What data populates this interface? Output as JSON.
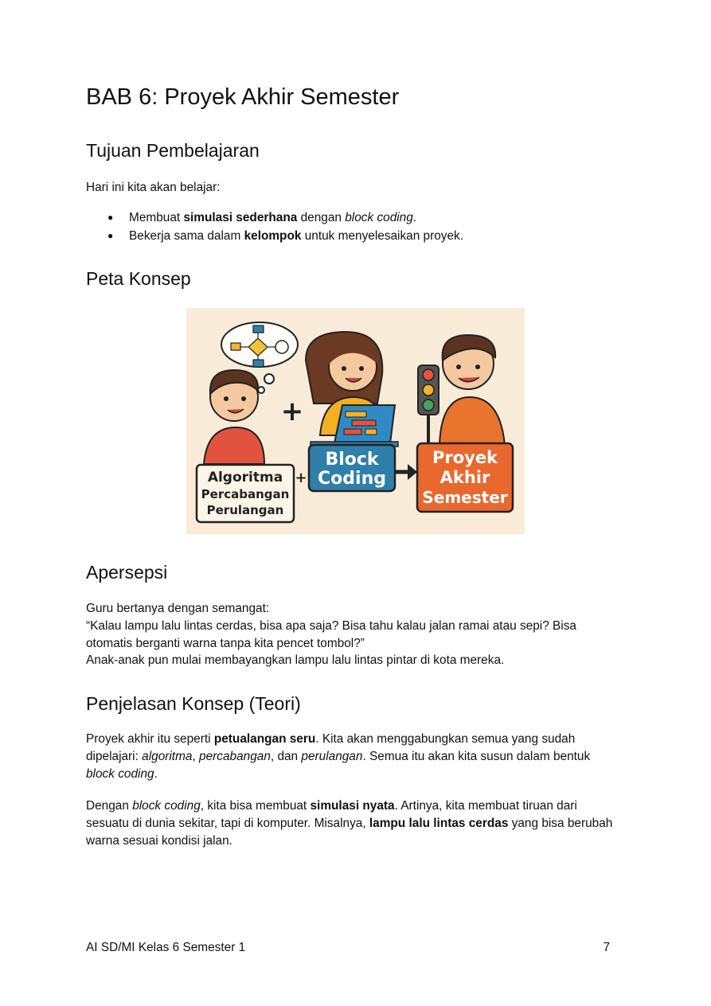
{
  "chapter_title": "BAB 6: Proyek Akhir Semester",
  "section1": {
    "heading": "Tujuan Pembelajaran",
    "intro": "Hari ini kita akan belajar:",
    "b1_pre": "Membuat ",
    "b1_bold": "simulasi sederhana",
    "b1_mid": " dengan ",
    "b1_ital": "block coding",
    "b1_end": ".",
    "b2_pre": "Bekerja sama dalam ",
    "b2_bold": "kelompok",
    "b2_end": " untuk menyelesaikan proyek."
  },
  "section2": {
    "heading": "Peta Konsep",
    "box1_l1": "Algoritma",
    "box1_l2": "Percabangan",
    "box1_l3": "Perulangan",
    "box2_l1": "Block",
    "box2_l2": "Coding",
    "box3_l1": "Proyek",
    "box3_l2": "Akhir",
    "box3_l3": "Semester",
    "plus": "+"
  },
  "section3": {
    "heading": "Apersepsi",
    "l1": "Guru bertanya dengan semangat:",
    "l2": "“Kalau lampu lalu lintas cerdas, bisa apa saja? Bisa tahu kalau jalan ramai atau sepi? Bisa otomatis berganti warna tanpa kita pencet tombol?”",
    "l3": "Anak-anak pun mulai membayangkan lampu lalu lintas pintar di kota mereka."
  },
  "section4": {
    "heading": "Penjelasan Konsep (Teori)",
    "p1_a": "Proyek akhir itu seperti ",
    "p1_b": "petualangan seru",
    "p1_c": ". Kita akan menggabungkan semua yang sudah dipelajari: ",
    "p1_d": "algoritma",
    "p1_e": ", ",
    "p1_f": "percabangan",
    "p1_g": ", dan ",
    "p1_h": "perulangan",
    "p1_i": ". Semua itu akan kita susun dalam bentuk ",
    "p1_j": "block coding",
    "p1_k": ".",
    "p2_a": "Dengan ",
    "p2_b": "block coding",
    "p2_c": ", kita bisa membuat ",
    "p2_d": "simulasi nyata",
    "p2_e": ". Artinya, kita membuat tiruan dari sesuatu di dunia sekitar, tapi di komputer. Misalnya, ",
    "p2_f": "lampu lalu lintas cerdas",
    "p2_g": " yang bisa berubah warna sesuai kondisi jalan."
  },
  "footer": {
    "left": "AI SD/MI Kelas 6 Semester 1",
    "page": "7"
  }
}
